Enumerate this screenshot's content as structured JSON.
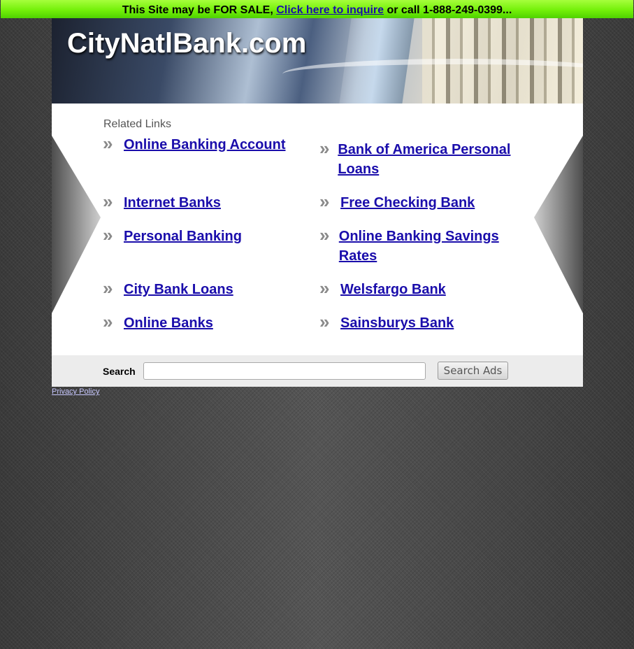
{
  "banner": {
    "prefix": "This Site may be FOR SALE, ",
    "link_text": "Click here to inquire",
    "suffix": " or call 1-888-249-0399..."
  },
  "header": {
    "site_title": "CityNatlBank.com"
  },
  "main": {
    "related_heading": "Related Links",
    "arrow_glyph": "»",
    "links": [
      {
        "label": "Online Banking Account"
      },
      {
        "label": "Bank of America Personal Loans"
      },
      {
        "label": "Internet Banks"
      },
      {
        "label": "Free Checking Bank"
      },
      {
        "label": "Personal Banking"
      },
      {
        "label": "Online Banking Savings Rates"
      },
      {
        "label": "City Bank Loans"
      },
      {
        "label": "Welsfargo Bank"
      },
      {
        "label": "Online Banks"
      },
      {
        "label": "Sainsburys Bank"
      }
    ]
  },
  "search": {
    "label": "Search",
    "value": "",
    "button_label": "Search Ads"
  },
  "footer": {
    "privacy_label": "Privacy Policy"
  },
  "colors": {
    "banner_green": "#74f00a",
    "link_blue": "#1a0dab",
    "background": "#4a4a4a"
  }
}
